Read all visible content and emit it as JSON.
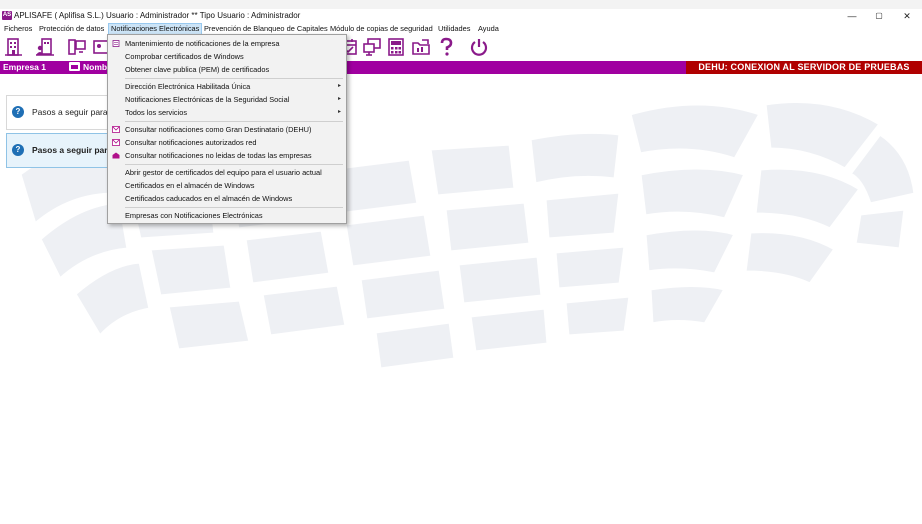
{
  "window": {
    "app_badge": "AS",
    "title": "APLISAFE  ( Aplifisa S.L.)   Usuario : Administrador  **  Tipo Usuario : Administrador",
    "minimize": "—",
    "maximize": "▢",
    "close": "✕"
  },
  "menubar": {
    "items": [
      "Ficheros",
      "Protección de datos",
      "Notificaciones Electrónicas",
      "Prevención de Blanqueo de Capitales",
      "Módulo de copias de seguridad",
      "Utilidades",
      "Ayuda"
    ]
  },
  "header": {
    "empresa": "Empresa 1",
    "nombre": "Nomb",
    "banner": "DEHU: CONEXION AL SERVIDOR DE PRUEBAS"
  },
  "panels": [
    {
      "text": "Pasos a seguir para c"
    },
    {
      "text": "Pasos a seguir para"
    }
  ],
  "dropdown": {
    "items": [
      {
        "label": "Mantenimiento de notificaciones de la empresa",
        "icon": "document-icon"
      },
      {
        "label": "Comprobar certificados de Windows"
      },
      {
        "label": "Obtener clave publica (PEM) de certificados"
      },
      {
        "label": "Dirección Electrónica Habilitada Única",
        "submenu": "▸"
      },
      {
        "label": "Notificaciones Electrónicas de la Seguridad Social",
        "submenu": "▸"
      },
      {
        "label": "Todos los servicios",
        "submenu": "▸"
      },
      {
        "label": "Consultar notificaciones como Gran Destinatario (DEHU)",
        "icon": "mail-icon"
      },
      {
        "label": "Consultar notificaciones autorizados red",
        "icon": "mail-icon"
      },
      {
        "label": "Consultar notificaciones no leidas de todas las empresas",
        "icon": "open-mail-icon"
      },
      {
        "label": "Abrir gestor de certificados del equipo para el usuario actual"
      },
      {
        "label": "Certificados en el almacén de Windows"
      },
      {
        "label": "Certificados caducados en el almacén de Windows"
      },
      {
        "label": "Empresas con Notificaciones Electrónicas"
      }
    ]
  },
  "colors": {
    "accent": "#a000a0",
    "banner": "#b00000",
    "icon": "#8a1a8a",
    "help": "#1f6fb5"
  }
}
